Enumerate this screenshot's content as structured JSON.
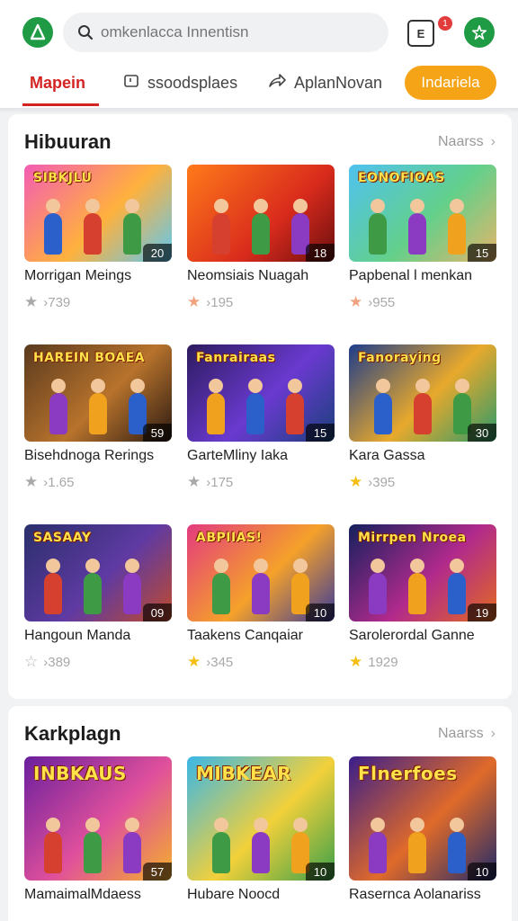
{
  "header": {
    "search_placeholder": "omkenlacca Innentisn",
    "notification_badge": "1"
  },
  "tabs": [
    {
      "label": "Mapein",
      "active": true
    },
    {
      "label": "ssoodsplaes",
      "icon": "tv-icon"
    },
    {
      "label": "AplanNovan",
      "icon": "share-icon"
    }
  ],
  "cta": {
    "label": "Indariela"
  },
  "sections": [
    {
      "title": "Hibuuran",
      "more": "Naarss",
      "items": [
        {
          "name": "Morrigan Meings",
          "rating": "›739",
          "count": "20",
          "banner": "SIBKJLU",
          "star": "gray",
          "bg": "linear-gradient(135deg,#f35cb4,#ffb13d 55%,#5cc8f2)"
        },
        {
          "name": "Neomsiais Nuagah",
          "rating": "›195",
          "count": "18",
          "banner": "",
          "star": "pink",
          "bg": "linear-gradient(135deg,#ff7a1a,#d92b1c 60%,#6b0f0f)"
        },
        {
          "name": "Papbenal l menkan",
          "rating": "›955",
          "count": "15",
          "banner": "EONOFIOAS",
          "star": "pink",
          "bg": "linear-gradient(135deg,#4fc2f0,#63d08a 55%,#e7b46a)"
        },
        {
          "name": "Bisehdnoga Rerings",
          "rating": "›1.65",
          "count": "59",
          "banner": "HAREIN BOAEA",
          "star": "gray",
          "bg": "linear-gradient(135deg,#5a3a1e,#b8732c 55%,#2b1a12)"
        },
        {
          "name": "GarteMliny  Iaka",
          "rating": "›175",
          "count": "15",
          "banner": "Fanrairaas",
          "star": "gray",
          "bg": "linear-gradient(135deg,#2d1b5e,#6a3ad0 55%,#1a3f7a)"
        },
        {
          "name": "Kara Gassa",
          "rating": "›395",
          "count": "30",
          "banner": "Fanoraying",
          "star": "gold",
          "bg": "linear-gradient(135deg,#1e3c8a,#e8a92c 55%,#2a9a6b)"
        },
        {
          "name": "Hangoun Manda",
          "rating": "›389",
          "count": "09",
          "banner": "SASAAY",
          "star": "outline",
          "bg": "linear-gradient(135deg,#2a2f6b,#5f3aa3 55%,#c04b2a)"
        },
        {
          "name": "Taakens Canqaiar",
          "rating": "›345",
          "count": "10",
          "banner": "ABPIIAS!",
          "star": "gold",
          "bg": "linear-gradient(135deg,#e33a7f,#f5a12a 55%,#3a3a9a)"
        },
        {
          "name": "Sarolerordal Ganne",
          "rating": "1929",
          "count": "19",
          "banner": "Mirrpen Nroea",
          "star": "gold",
          "bg": "linear-gradient(135deg,#14205e,#b12a8c 55%,#e36a1f)"
        }
      ]
    },
    {
      "title": "Karkplagn",
      "more": "Naarss",
      "items": [
        {
          "name": "MamaimalMdaess",
          "count": "57",
          "banner": "INBKAUS",
          "bg": "linear-gradient(135deg,#6a1f9e,#e0509c 55%,#f3b02a)"
        },
        {
          "name": "Hubare Noocd",
          "count": "10",
          "banner": "MIBKEAR",
          "bg": "linear-gradient(135deg,#39b7e8,#f2d03a 55%,#3aa04a)"
        },
        {
          "name": "Rasernca Aolanariss",
          "count": "10",
          "banner": "Flnerfoes",
          "bg": "linear-gradient(135deg,#3a1e8a,#e06a2a 55%,#1e2a6a)"
        }
      ]
    }
  ],
  "colors": {
    "accent_red": "#d32323",
    "cta_orange": "#f5a418",
    "brand_green": "#1f9a45"
  }
}
